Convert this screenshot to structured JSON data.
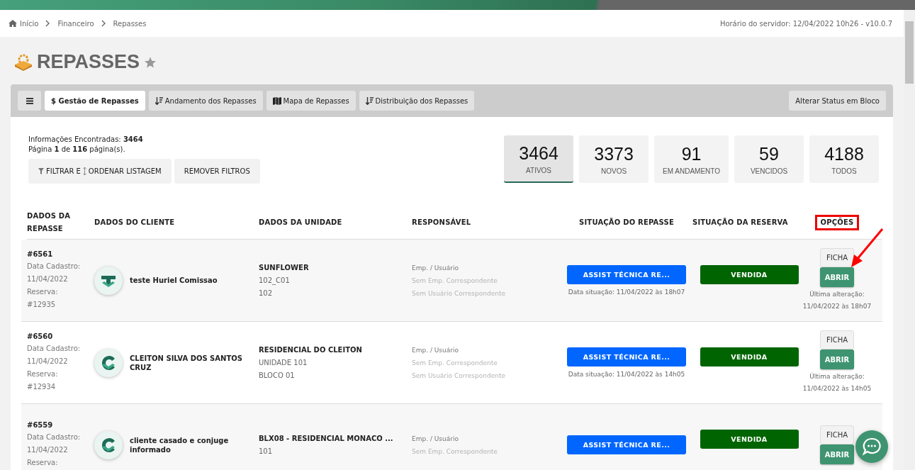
{
  "breadcrumb": [
    {
      "label": "Início",
      "kind": "home"
    },
    {
      "label": "Financeiro",
      "kind": "link"
    },
    {
      "label": "Repasses",
      "kind": "link"
    }
  ],
  "server_time": "Horário do servidor: 12/04/2022 10h26 - v10.0.7",
  "title": "REPASSES",
  "tabs": [
    {
      "label": "$ Gestão de Repasses",
      "kind": "plain",
      "selected": true
    },
    {
      "label": "Andamento dos Repasses",
      "kind": "sort",
      "selected": false
    },
    {
      "label": "Mapa de Repasses",
      "kind": "map",
      "selected": false
    },
    {
      "label": "Distribuição dos Repasses",
      "kind": "sort",
      "selected": false
    }
  ],
  "bulk_button": "Alterar Status em Bloco",
  "info": {
    "found": "Informações Encontradas: **3464**",
    "page": "Página **1** de **116** página(s)."
  },
  "filter_button": {
    "left": "FILTRAR E",
    "right": "ORDENAR LISTAGEM"
  },
  "remove_button": "REMOVER FILTROS",
  "stats": [
    {
      "value": "3464",
      "label": "ATIVOS",
      "selected": true
    },
    {
      "value": "3373",
      "label": "NOVOS",
      "selected": false
    },
    {
      "value": "91",
      "label": "EM ANDAMENTO",
      "selected": false
    },
    {
      "value": "59",
      "label": "VENCIDOS",
      "selected": false
    },
    {
      "value": "4188",
      "label": "TODOS",
      "selected": false
    }
  ],
  "columns": [
    {
      "label": "DADOS DA REPASSE",
      "highlighted": false
    },
    {
      "label": "DADOS DO CLIENTE",
      "highlighted": false
    },
    {
      "label": "DADOS DA UNIDADE",
      "highlighted": false
    },
    {
      "label": "RESPONSÁVEL",
      "highlighted": false
    },
    {
      "label": "SITUAÇÃO DO REPASSE",
      "highlighted": false
    },
    {
      "label": "SITUAÇÃO DA RESERVA",
      "highlighted": false
    },
    {
      "label": "OPÇÕES",
      "highlighted": true
    }
  ],
  "rows": [
    {
      "id": "#6561",
      "meta": [
        "Data Cadastro:",
        "11/04/2022",
        "Reserva:",
        "#12935"
      ],
      "kind": "t",
      "client": "teste Huriel Comissao",
      "unit": [
        {
          "text": "SUNFLOWER",
          "bold": true
        },
        {
          "text": "102_C01",
          "bold": false
        },
        {
          "text": "102",
          "bold": false
        }
      ],
      "responsible": [
        {
          "text": "Emp. / Usuário",
          "muted": false
        },
        {
          "text": "Sem Emp. Correspondente",
          "muted": true
        },
        {
          "text": "Sem Usuário Correspondente",
          "muted": true
        }
      ],
      "status": "ASSIST TÉCNICA RE...",
      "status_date": "Data situação: 11/04/2022 às 18h07",
      "reservation": "VENDIDA",
      "ficha": "FICHA",
      "abrir": "ABRIR",
      "last_change": [
        "Última alteração:",
        "11/04/2022 às 18h07"
      ],
      "pointed": true
    },
    {
      "id": "#6560",
      "meta": [
        "Data Cadastro:",
        "11/04/2022",
        "Reserva:",
        "#12934"
      ],
      "kind": "c",
      "client": "CLEITON SILVA DOS SANTOS CRUZ",
      "unit": [
        {
          "text": "RESIDENCIAL DO CLEITON",
          "bold": true
        },
        {
          "text": "UNIDADE 101",
          "bold": false
        },
        {
          "text": "BLOCO 01",
          "bold": false
        }
      ],
      "responsible": [
        {
          "text": "Emp. / Usuário",
          "muted": false
        },
        {
          "text": "Sem Emp. Correspondente",
          "muted": true
        },
        {
          "text": "Sem Usuário Correspondente",
          "muted": true
        }
      ],
      "status": "ASSIST TÉCNICA RE...",
      "status_date": "Data situação: 11/04/2022 às 14h05",
      "reservation": "VENDIDA",
      "ficha": "FICHA",
      "abrir": "ABRIR",
      "last_change": [
        "Última alteração:",
        "11/04/2022 às 14h05"
      ],
      "pointed": false
    },
    {
      "id": "#6559",
      "meta": [
        "Data Cadastro:",
        "11/04/2022",
        "Reserva:"
      ],
      "kind": "c",
      "client": "cliente casado e conjuge informado",
      "unit": [
        {
          "text": "BLX08 - RESIDENCIAL MONACO ...",
          "bold": true
        },
        {
          "text": "101",
          "bold": false
        }
      ],
      "responsible": [
        {
          "text": "Emp. / Usuário",
          "muted": false
        },
        {
          "text": "Sem Emp. Correspondente",
          "muted": true
        }
      ],
      "status": "ASSIST TÉCNICA RE...",
      "reservation": "VENDIDA",
      "ficha": "FICHA",
      "abrir": "ABRIR",
      "pointed": false
    }
  ]
}
